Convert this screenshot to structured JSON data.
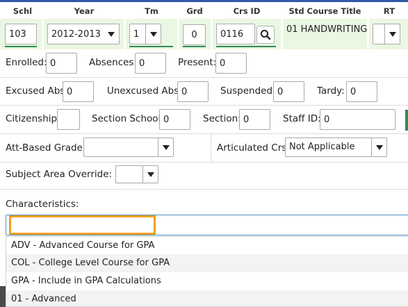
{
  "columns": [
    "Schl",
    "Year",
    "Tm",
    "Grd",
    "Crs ID",
    "Std Course Title",
    "RT"
  ],
  "course": {
    "schl": "103",
    "year": "2012-2013",
    "tm": "1",
    "grd": "0",
    "crs_id": "0116",
    "std_course_title": "01 HANDWRITING",
    "rt": ""
  },
  "row2": {
    "enrolled_label": "Enrolled:",
    "enrolled": "0",
    "absences_label": "Absences:",
    "absences": "0",
    "present_label": "Present:",
    "present": "0"
  },
  "row3": {
    "excused_label": "Excused Abs:",
    "excused": "0",
    "unexcused_label": "Unexcused Abs:",
    "unexcused": "0",
    "suspended_label": "Suspended:",
    "suspended": "0",
    "tardy_label": "Tardy:",
    "tardy": "0"
  },
  "row4": {
    "citizenship_label": "Citizenship:",
    "citizenship": "",
    "section_school_label": "Section School:",
    "section_school": "0",
    "section_label": "Section:",
    "section": "0",
    "staff_id_label": "Staff ID:",
    "staff_id": "0"
  },
  "row5": {
    "att_grade_label": "Att-Based Grade:",
    "att_grade": "",
    "articulated_label": "Articulated Crs:",
    "articulated": "Not Applicable"
  },
  "row6": {
    "subject_override_label": "Subject Area Override:",
    "subject_override": ""
  },
  "characteristics": {
    "label": "Characteristics:",
    "value": "",
    "options": [
      "ADV - Advanced Course for GPA",
      "COL - College Level Course for GPA",
      "GPA - Include in GPA Calculations",
      "01 - Advanced"
    ]
  },
  "colors": {
    "accent": "#2f5aa8",
    "green_row": "#eaf7e2",
    "green_line": "#2e8b57",
    "highlight": "#f0a020"
  }
}
